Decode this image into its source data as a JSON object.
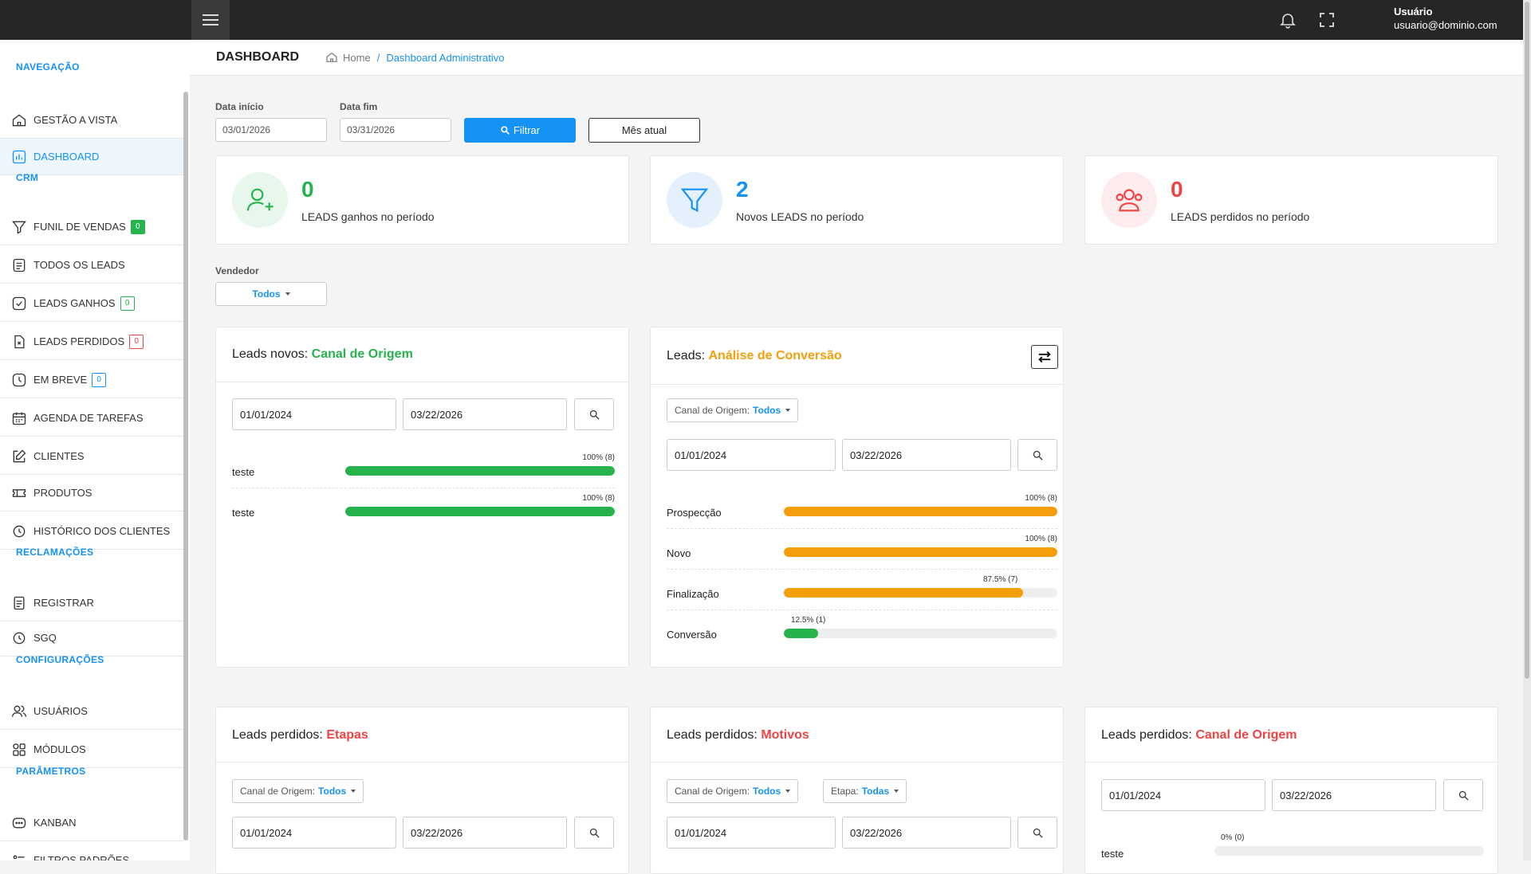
{
  "topbar": {
    "user_name": "Usuário",
    "user_email": "usuario@dominio.com"
  },
  "sidebar": {
    "sections": [
      "NAVEGAÇÃO",
      "CRM",
      "RECLAMAÇÕES",
      "CONFIGURAÇÕES",
      "PARÂMETROS"
    ],
    "items": [
      {
        "label": "GESTÃO A VISTA"
      },
      {
        "label": "DASHBOARD"
      },
      {
        "label": "FUNIL DE VENDAS",
        "badge": "0"
      },
      {
        "label": "TODOS OS LEADS"
      },
      {
        "label": "LEADS GANHOS",
        "badge": "0"
      },
      {
        "label": "LEADS PERDIDOS",
        "badge": "0"
      },
      {
        "label": "EM BREVE",
        "badge": "0"
      },
      {
        "label": "AGENDA DE TAREFAS"
      },
      {
        "label": "CLIENTES"
      },
      {
        "label": "PRODUTOS"
      },
      {
        "label": "HISTÓRICO DOS CLIENTES"
      },
      {
        "label": "REGISTRAR"
      },
      {
        "label": "SGQ"
      },
      {
        "label": "USUÁRIOS"
      },
      {
        "label": "MÓDULOS"
      },
      {
        "label": "KANBAN"
      },
      {
        "label": "FILTROS PADRÕES"
      }
    ]
  },
  "header": {
    "title": "DASHBOARD",
    "crumb_home": "Home",
    "crumb_sep": "/",
    "crumb_current": "Dashboard Administrativo"
  },
  "filters": {
    "start_label": "Data início",
    "start_value": "03/01/2026",
    "end_label": "Data fim",
    "end_value": "03/31/2026",
    "filter_button": "Filtrar",
    "month_button": "Mês atual",
    "seller_label": "Vendedor",
    "seller_value": "Todos"
  },
  "stats": [
    {
      "value": "0",
      "label": "LEADS ganhos no período",
      "color": "#26b24c"
    },
    {
      "value": "2",
      "label": "Novos LEADS no período",
      "color": "#1492f5"
    },
    {
      "value": "0",
      "label": "LEADS perdidos no período",
      "color": "#ef4444"
    }
  ],
  "canal": {
    "title_prefix": "Leads novos:",
    "title_highlight": "Canal de Origem",
    "date_start": "01/01/2024",
    "date_end": "03/22/2026",
    "rows": [
      {
        "label": "teste",
        "pct": 100,
        "text": "100% (8)"
      },
      {
        "label": "teste",
        "pct": 100,
        "text": "100% (8)"
      }
    ]
  },
  "conversao": {
    "title_prefix": "Leads:",
    "title_highlight": "Análise de Conversão",
    "select_label": "Canal de Origem:",
    "select_value": "Todos",
    "date_start": "01/01/2024",
    "date_end": "03/22/2026",
    "rows": [
      {
        "label": "Prospecção",
        "pct": 100,
        "text": "100% (8)",
        "color": "#f59e0b"
      },
      {
        "label": "Novo",
        "pct": 100,
        "text": "100% (8)",
        "color": "#f59e0b"
      },
      {
        "label": "Finalização",
        "pct": 87.5,
        "text": "87.5% (7)",
        "color": "#f59e0b"
      },
      {
        "label": "Conversão",
        "pct": 12.5,
        "text": "12.5% (1)",
        "color": "#26b24c"
      }
    ]
  },
  "perdidos_etapas": {
    "title_prefix": "Leads perdidos:",
    "title_highlight": "Etapas",
    "select_label": "Canal de Origem:",
    "select_value": "Todos",
    "date_start": "01/01/2024",
    "date_end": "03/22/2026"
  },
  "perdidos_motivos": {
    "title_prefix": "Leads perdidos:",
    "title_highlight": "Motivos",
    "select_label": "Canal de Origem:",
    "select_value": "Todos",
    "select2_label": "Etapa:",
    "select2_value": "Todas",
    "date_start": "01/01/2024",
    "date_end": "03/22/2026"
  },
  "perdidos_canal": {
    "title_prefix": "Leads perdidos:",
    "title_highlight": "Canal de Origem",
    "date_start": "01/01/2024",
    "date_end": "03/22/2026",
    "row_label": "teste",
    "row_pct": 0,
    "row_text": "0% (0)"
  }
}
